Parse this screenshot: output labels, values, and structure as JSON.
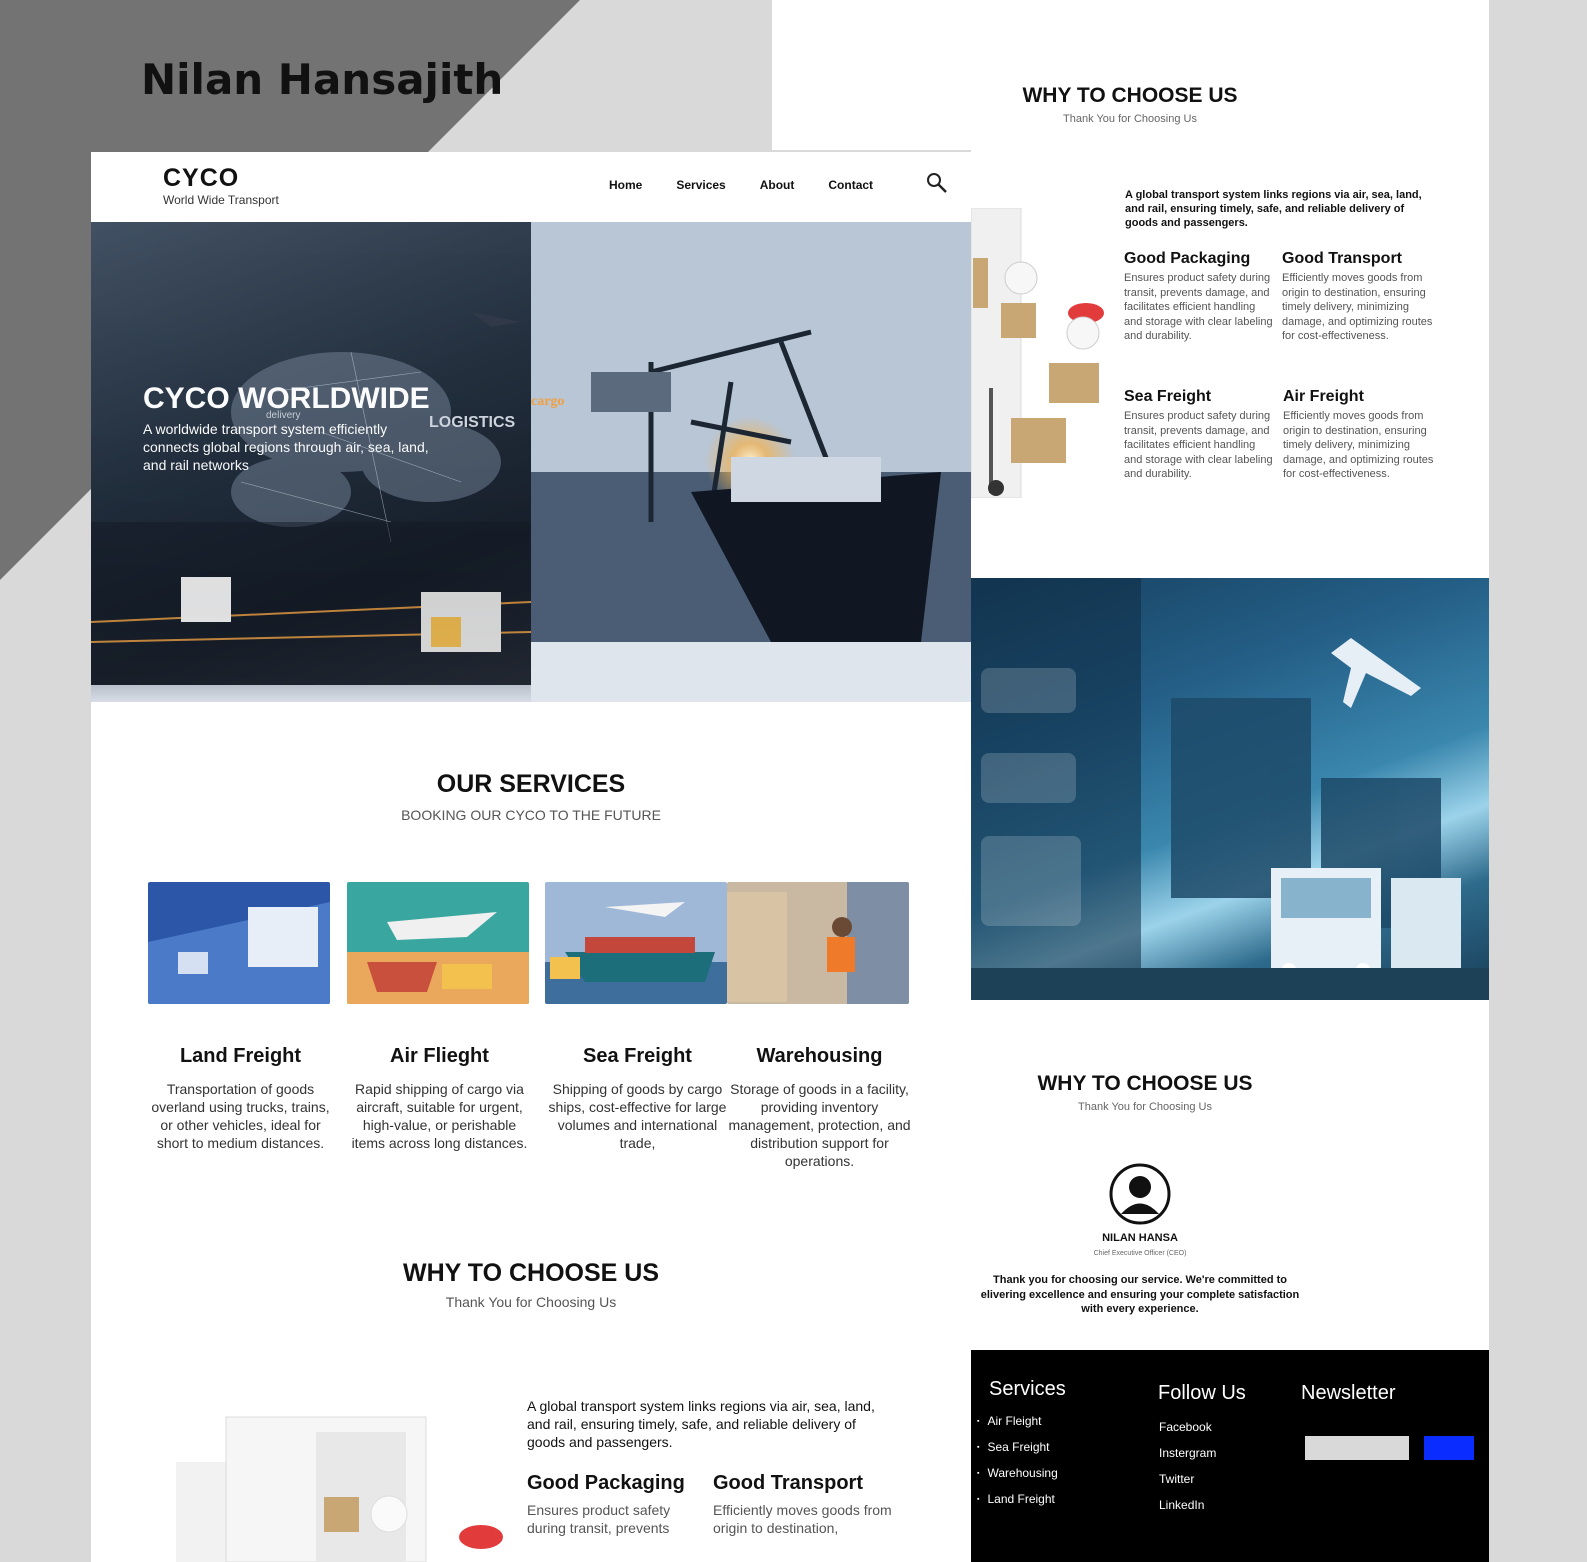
{
  "author": "Nilan Hansajith",
  "left_page": {
    "brand": {
      "title": "CYCO",
      "subtitle": "World Wide Transport"
    },
    "nav": [
      "Home",
      "Services",
      "About",
      "Contact"
    ],
    "hero": {
      "title": "CYCO WORLDWIDE",
      "description": "A worldwide transport system efficiently connects global regions through air, sea, land, and rail networks",
      "image_words": [
        "cargo",
        "LOGISTICS",
        "delivery"
      ]
    },
    "services": {
      "title": "OUR SERVICES",
      "subtitle": "BOOKING OUR CYCO TO THE FUTURE",
      "items": [
        {
          "title": "Land Freight",
          "description": "Transportation of goods overland using trucks, trains, or other vehicles, ideal for short to medium distances."
        },
        {
          "title": "Air Flieght",
          "description": "Rapid shipping of cargo via aircraft, suitable for urgent, high-value, or perishable items across long distances."
        },
        {
          "title": "Sea Freight",
          "description": "Shipping of goods by cargo ships, cost-effective for large volumes and international trade,"
        },
        {
          "title": "Warehousing",
          "description": "Storage of goods in a facility, providing inventory management, protection, and distribution support for operations."
        }
      ]
    },
    "why": {
      "title": "WHY TO CHOOSE US",
      "subtitle": "Thank You for Choosing Us",
      "intro": "A global transport system links regions via air, sea, land, and rail, ensuring timely, safe, and reliable delivery of goods and passengers.",
      "col1_title": "Good Packaging",
      "col1_text": "Ensures product safety during transit, prevents",
      "col2_title": "Good Transport",
      "col2_text": "Efficiently moves goods from origin to destination,"
    }
  },
  "right_page": {
    "why": {
      "title": "WHY TO CHOOSE US",
      "subtitle": "Thank You for Choosing Us",
      "intro": "A global transport system links regions via air, sea, land, and rail, ensuring timely, safe, and reliable delivery of goods and passengers.",
      "features": [
        {
          "title": "Good Packaging",
          "text": "Ensures product safety during transit, prevents damage, and facilitates efficient handling and storage with clear labeling and durability."
        },
        {
          "title": "Good Transport",
          "text": "Efficiently moves goods from origin to destination, ensuring timely delivery, minimizing damage, and optimizing routes for cost-effectiveness."
        },
        {
          "title": "Sea Freight",
          "text": "Ensures product safety during transit, prevents damage, and facilitates efficient handling and storage with clear labeling and durability."
        },
        {
          "title": "Air Freight",
          "text": "Efficiently moves goods from origin to destination, ensuring timely delivery, minimizing damage, and optimizing routes for cost-effectiveness."
        }
      ]
    },
    "testimonial": {
      "title": "WHY TO CHOOSE US",
      "subtitle": "Thank You for Choosing Us",
      "name": "NILAN HANSA",
      "role": "Chief Executive Officer (CEO)",
      "message": "Thank you for choosing our service. We're committed to elivering excellence and ensuring your complete satisfaction with every experience."
    },
    "footer": {
      "services_title": "Services",
      "services": [
        "Air Fleight",
        "Sea Freight",
        "Warehousing",
        "Land Freight"
      ],
      "follow_title": "Follow Us",
      "follow": [
        "Facebook",
        "Instergram",
        "Twitter",
        "LinkedIn"
      ],
      "newsletter_title": "Newsletter"
    }
  },
  "colors": {
    "accent_blue": "#0a2cff",
    "footer_bg": "#000000",
    "bg_gray": "#d9d9d9",
    "dark_gray": "#737373"
  }
}
